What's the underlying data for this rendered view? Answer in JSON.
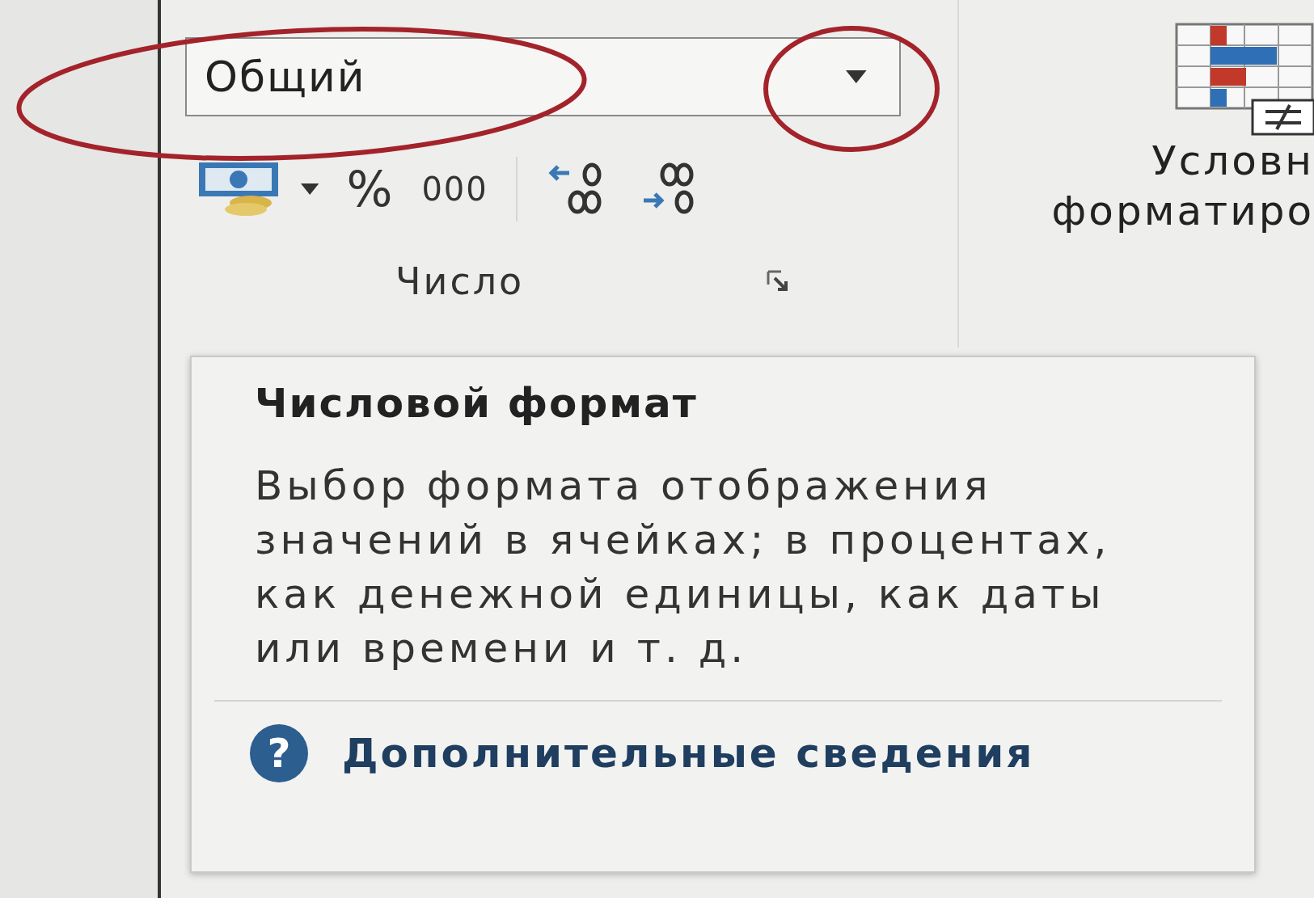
{
  "number_format": {
    "value": "Общий"
  },
  "number_buttons": [
    {
      "kind": "currency"
    },
    {
      "kind": "text",
      "label": "%"
    },
    {
      "kind": "text",
      "label": "000"
    },
    {
      "kind": "divider"
    },
    {
      "kind": "increase-decimal"
    },
    {
      "kind": "decrease-decimal"
    }
  ],
  "number_group": {
    "label": "Число"
  },
  "conditional_formatting": {
    "lines": [
      "Условн",
      "форматиро"
    ]
  },
  "tooltip": {
    "title": "Числовой формат",
    "body": "Выбор формата отображения значений в ячейках; в процентах, как денежной единицы, как даты или времени и т. д.",
    "help_glyph": "?",
    "link": "Дополнительные сведения"
  }
}
